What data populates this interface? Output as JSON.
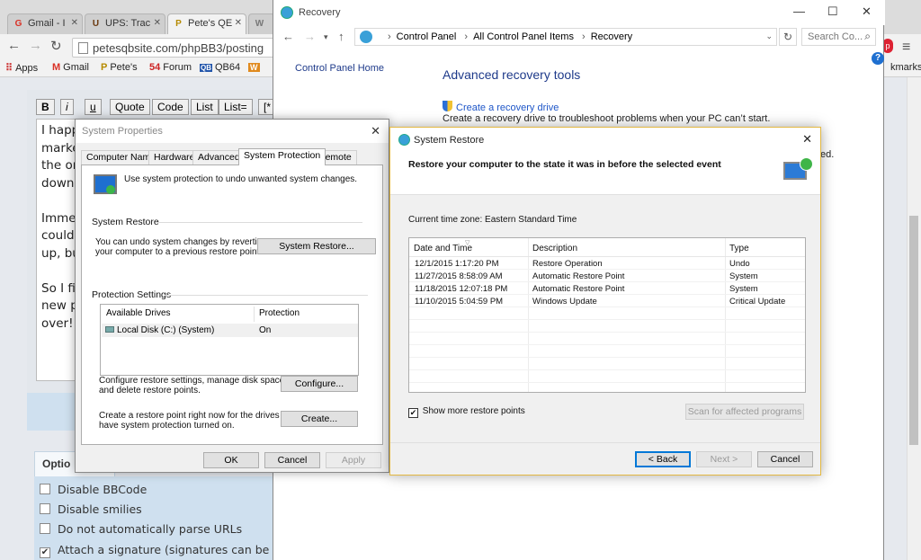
{
  "chrome": {
    "tabs": [
      {
        "label": "Gmail - I",
        "icon": "G"
      },
      {
        "label": "UPS: Trac",
        "icon": "U"
      },
      {
        "label": "Pete's QE",
        "icon": "P"
      },
      {
        "label": "W",
        "icon": "W"
      }
    ],
    "url": "petesqbsite.com/phpBB3/posting",
    "bookmarks": [
      {
        "label": "Apps",
        "icon": "apps-grid-icon"
      },
      {
        "label": "Gmail",
        "icon": "M"
      },
      {
        "label": "Pete's",
        "icon": "P"
      },
      {
        "label": "Forum",
        "icon": "54"
      },
      {
        "label": "QB64",
        "icon": "QB"
      },
      {
        "label": "W",
        "icon": "W"
      }
    ],
    "bookmarks_right": "kmarks",
    "bbcode_buttons": [
      "B",
      "i",
      "u",
      "Quote",
      "Code",
      "List",
      "List=",
      "[*"
    ],
    "editor_lines": [
      "I happ",
      "marke",
      "the on",
      "downl",
      "",
      "Immed",
      "could",
      "up, bu",
      "",
      "So I fi",
      "new p",
      "over!"
    ],
    "options_tab": "Optio",
    "options": [
      {
        "label": "Disable BBCode",
        "checked": false
      },
      {
        "label": "Disable smilies",
        "checked": false
      },
      {
        "label": "Do not automatically parse URLs",
        "checked": false
      },
      {
        "label": "Attach a signature (signatures can be alt",
        "checked": true
      }
    ]
  },
  "recovery": {
    "title": "Recovery",
    "breadcrumb": [
      "Control Panel",
      "All Control Panel Items",
      "Recovery"
    ],
    "search_placeholder": "Search Co...",
    "left_link": "Control Panel Home",
    "heading": "Advanced recovery tools",
    "link": "Create a recovery drive",
    "link_desc": "Create a recovery drive to troubleshoot problems when your PC can’t start.",
    "peek_text": "ed."
  },
  "system_properties": {
    "title": "System Properties",
    "tabs": [
      "Computer Name",
      "Hardware",
      "Advanced",
      "System Protection",
      "Remote"
    ],
    "active_tab": "System Protection",
    "intro": "Use system protection to undo unwanted system changes.",
    "restore_group": "System Restore",
    "restore_desc": [
      "You can undo system changes by reverting",
      "your computer to a previous restore point."
    ],
    "restore_button": "System Restore...",
    "protection_group": "Protection Settings",
    "drives_headers": [
      "Available Drives",
      "Protection"
    ],
    "drives": [
      {
        "name": "Local Disk (C:) (System)",
        "protection": "On"
      }
    ],
    "configure_desc": [
      "Configure restore settings, manage disk space,",
      "and delete restore points."
    ],
    "configure_button": "Configure...",
    "create_desc": [
      "Create a restore point right now for the drives that",
      "have system protection turned on."
    ],
    "create_button": "Create...",
    "ok": "OK",
    "cancel": "Cancel",
    "apply": "Apply"
  },
  "system_restore": {
    "title": "System Restore",
    "header": "Restore your computer to the state it was in before the selected event",
    "timezone": "Current time zone: Eastern Standard Time",
    "columns": [
      "Date and Time",
      "Description",
      "Type"
    ],
    "rows": [
      [
        "12/1/2015 1:17:20 PM",
        "Restore Operation",
        "Undo"
      ],
      [
        "11/27/2015 8:58:09 AM",
        "Automatic Restore Point",
        "System"
      ],
      [
        "11/18/2015 12:07:18 PM",
        "Automatic Restore Point",
        "System"
      ],
      [
        "11/10/2015 5:04:59 PM",
        "Windows Update",
        "Critical Update"
      ]
    ],
    "show_more": "Show more restore points",
    "show_more_checked": true,
    "scan_button": "Scan for affected programs",
    "back_button": "< Back",
    "next_button": "Next >",
    "cancel_button": "Cancel"
  }
}
